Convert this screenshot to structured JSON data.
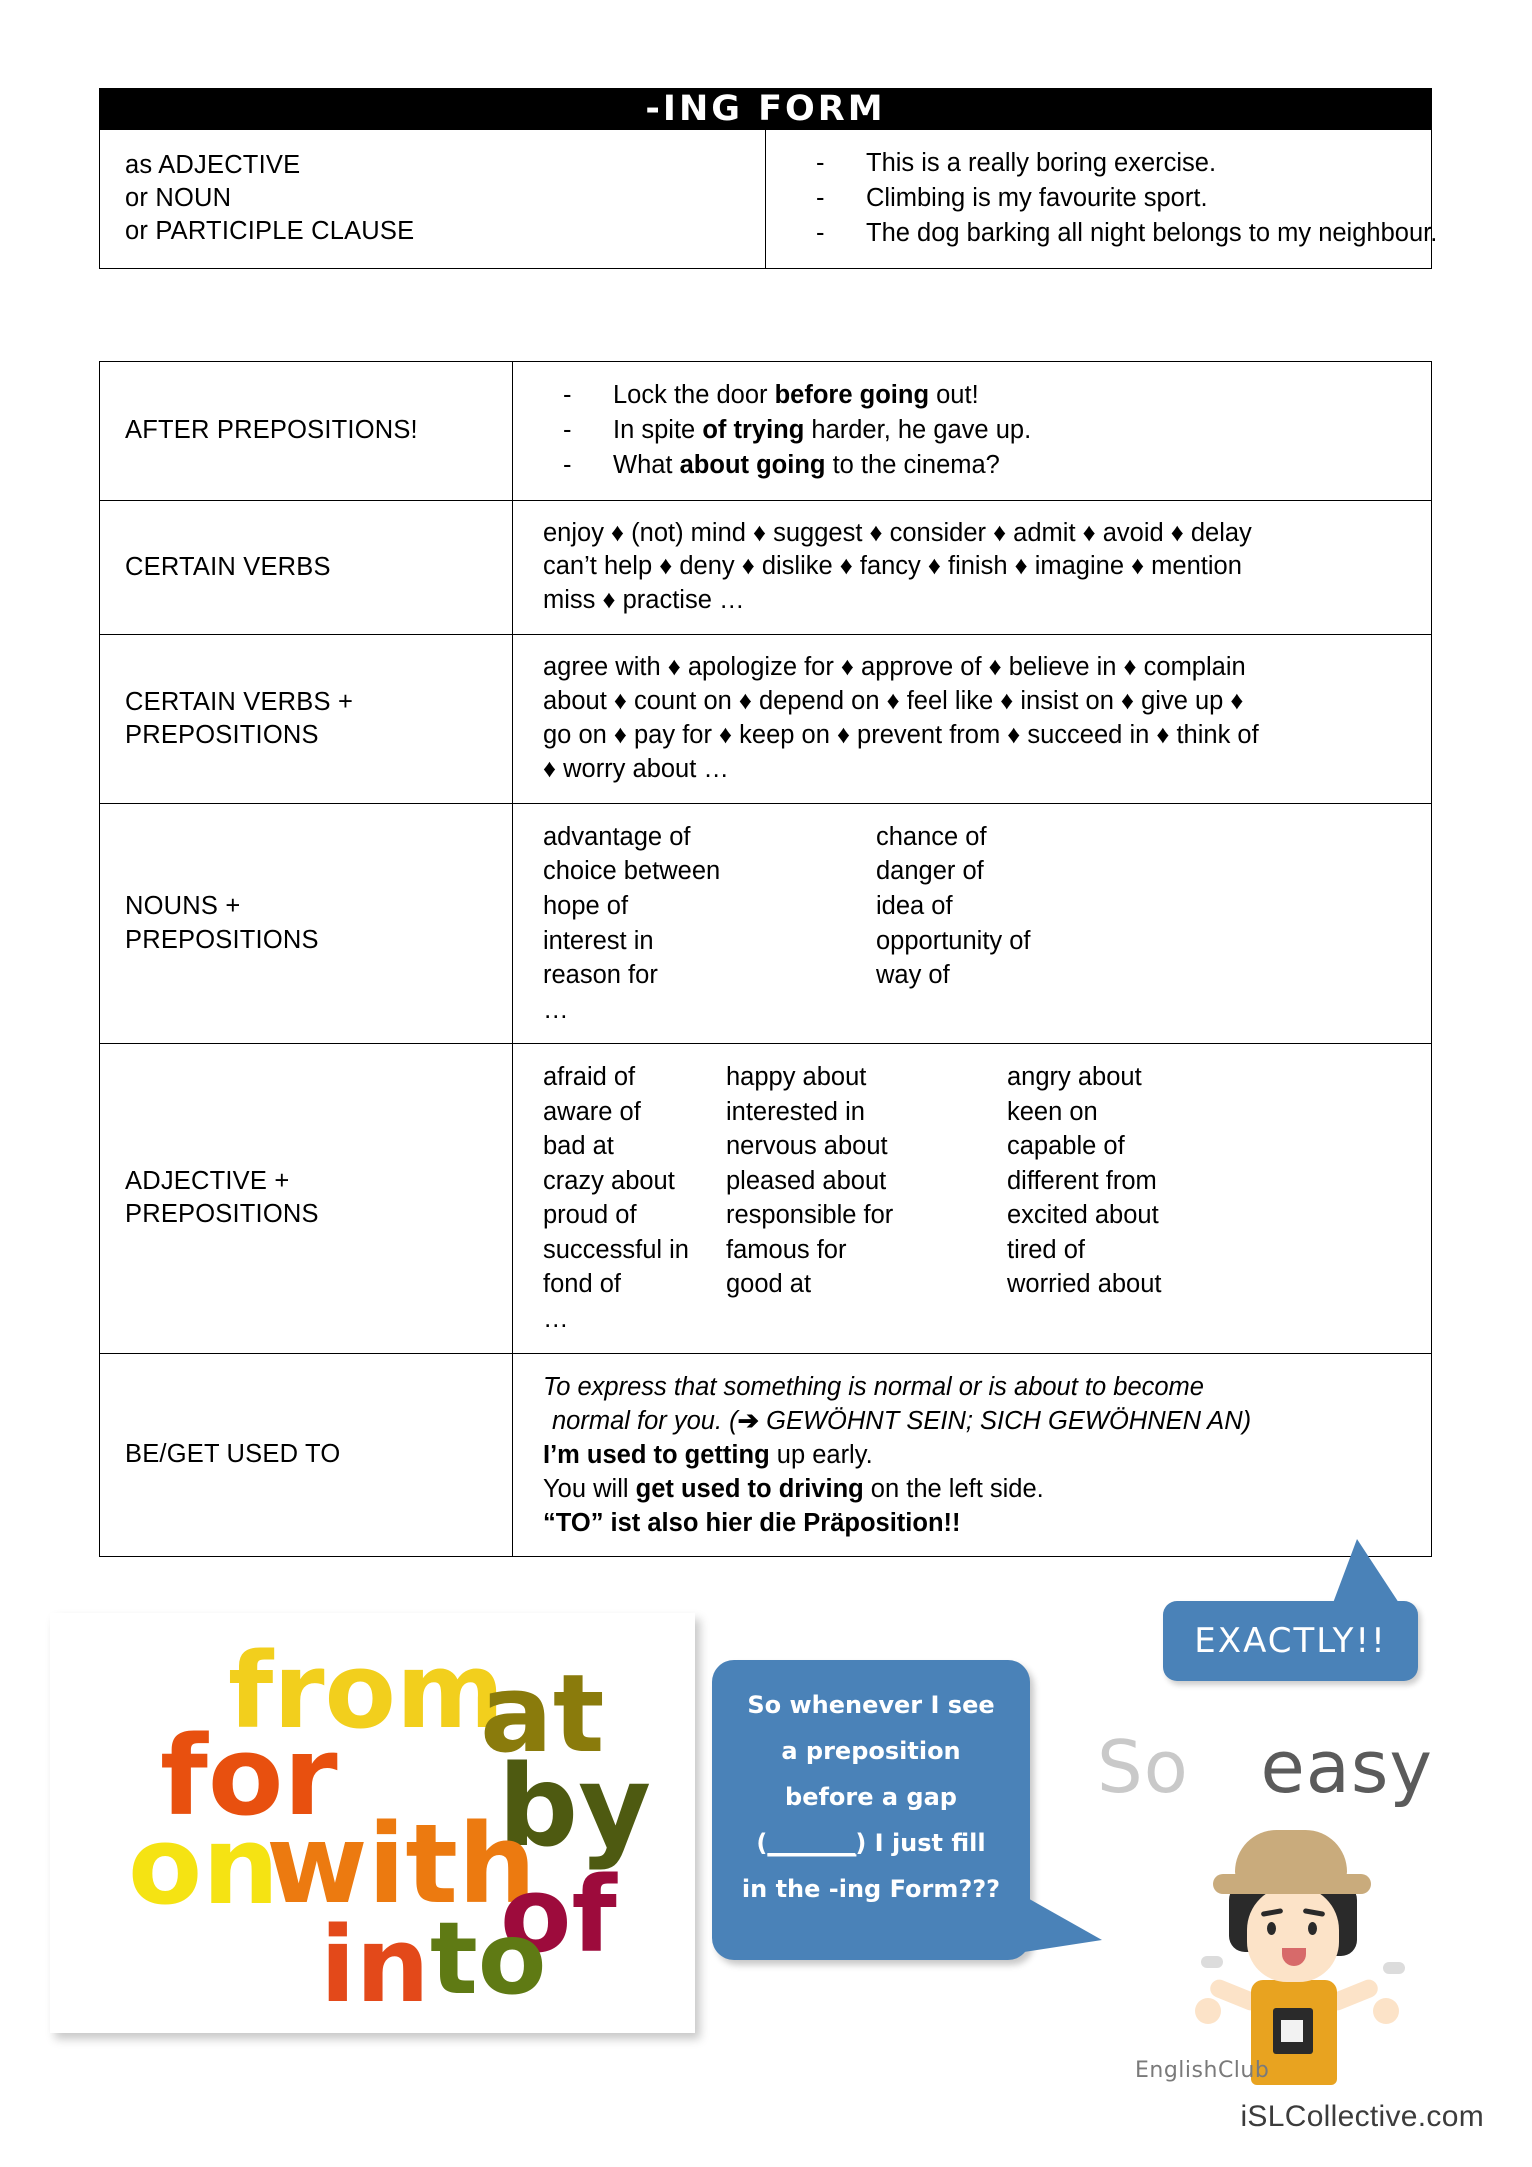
{
  "worksheet": {
    "title": "-ING FORM",
    "footer_brand": "iSLCollective.com",
    "watermark": "EnglishClub"
  },
  "table_top": {
    "rows": [
      {
        "category": [
          "as ADJECTIVE",
          "or NOUN",
          "or PARTICIPLE CLAUSE"
        ],
        "examples": [
          "This is a really boring exercise.",
          "Climbing is my favourite sport.",
          "The dog barking all night belongs to my neighbour."
        ]
      }
    ]
  },
  "table_main": {
    "after_prepositions": {
      "category": "AFTER PREPOSITIONS!",
      "examples": [
        {
          "pre": "Lock the door ",
          "bold": "before going",
          "post": " out!"
        },
        {
          "pre": "In spite ",
          "bold": "of trying",
          "post": " harder, he gave up."
        },
        {
          "pre": "What ",
          "bold": "about going",
          "post": " to the cinema?"
        }
      ]
    },
    "certain_verbs": {
      "category": "CERTAIN VERBS",
      "lines": [
        "enjoy ♦ (not) mind ♦ suggest ♦ consider ♦ admit ♦ avoid ♦ delay",
        "can’t help ♦ deny ♦ dislike ♦ fancy ♦ finish ♦ imagine ♦ mention",
        "miss ♦ practise …"
      ]
    },
    "certain_verbs_prepositions": {
      "category": [
        "CERTAIN VERBS +",
        "PREPOSITIONS"
      ],
      "lines": [
        "agree with ♦ apologize for ♦ approve of ♦ believe in ♦ complain",
        "about ♦ count on ♦ depend on ♦ feel like ♦ insist on ♦ give up ♦",
        "go on ♦ pay for ♦ keep on ♦ prevent from ♦ succeed in ♦ think of",
        "♦ worry about …"
      ]
    },
    "nouns_prepositions": {
      "category": [
        "NOUNS +",
        "PREPOSITIONS"
      ],
      "pairs": [
        [
          "advantage of",
          "chance of"
        ],
        [
          "choice between",
          "danger of"
        ],
        [
          "hope of",
          "idea of"
        ],
        [
          "interest in",
          "opportunity of"
        ],
        [
          "reason for",
          "way of"
        ]
      ],
      "ellipsis": "…"
    },
    "adjective_prepositions": {
      "category": [
        "ADJECTIVE +",
        "PREPOSITIONS"
      ],
      "triples": [
        [
          "afraid of",
          "happy about",
          "angry about"
        ],
        [
          "aware of",
          "interested in",
          "keen on"
        ],
        [
          "bad at",
          "nervous about",
          "capable of"
        ],
        [
          "crazy about",
          "pleased about",
          "different from"
        ],
        [
          "proud of",
          "responsible for",
          "excited about"
        ],
        [
          "successful in",
          "famous for",
          "tired of"
        ],
        [
          "fond of",
          "good at",
          "worried about"
        ]
      ],
      "ellipsis": "…"
    },
    "be_get_used_to": {
      "category": "BE/GET USED TO",
      "italic_line1": "To express that something is normal or is about to become",
      "italic_line2_pre": "normal for you. (",
      "italic_arrow": "➔",
      "italic_line2_post": " GEWÖHNT SEIN; SICH GEWÖHNEN AN)",
      "example1_bold": "I’m used to getting",
      "example1_post": " up early.",
      "example2_pre": "You will ",
      "example2_bold": "get used to driving",
      "example2_post": " on the left side.",
      "note_bold": "“TO” ist also hier die Präposition!!"
    }
  },
  "graphics": {
    "word_cloud": {
      "words": [
        {
          "text": "from",
          "color": "#f2cf1d"
        },
        {
          "text": "at",
          "color": "#8a7b0c"
        },
        {
          "text": "for",
          "color": "#e8500f"
        },
        {
          "text": "by",
          "color": "#4e5a11"
        },
        {
          "text": "on",
          "color": "#f5e313"
        },
        {
          "text": "with",
          "color": "#ec7a10"
        },
        {
          "text": "of",
          "color": "#9d0b3c"
        },
        {
          "text": "in",
          "color": "#e3491a"
        },
        {
          "text": "to",
          "color": "#5f7a14"
        }
      ]
    },
    "speech_bubble": {
      "line1": "So whenever I see",
      "line2": "a preposition",
      "line3": "before a gap",
      "line4_open": "(",
      "line4_gap": "________",
      "line4_close": ") I just fill",
      "line5": "in the -ing Form???",
      "color": "#4a82b8"
    },
    "exactly_bubble": {
      "text": "EXACTLY!!",
      "color": "#4a82b8"
    },
    "so_easy": {
      "word1": "So",
      "word2": "easy",
      "color1": "#c9c9c9",
      "color2": "#5b5b5b"
    }
  }
}
